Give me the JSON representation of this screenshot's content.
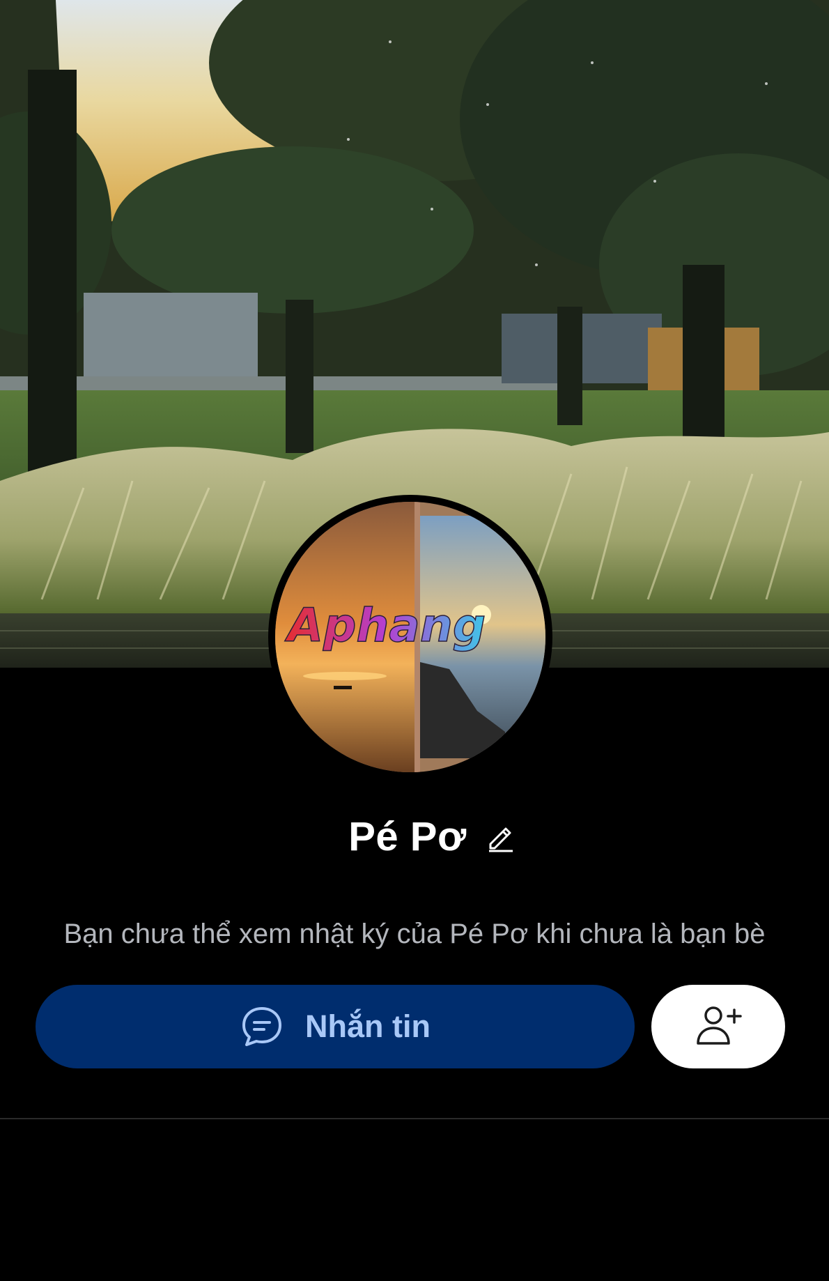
{
  "profile": {
    "name": "Pé Pơ",
    "notice": "Bạn chưa thể xem nhật ký của Pé Pơ khi chưa là bạn bè",
    "avatar_watermark": "Aphang"
  },
  "actions": {
    "message_label": "Nhắn tin"
  },
  "icons": {
    "edit": "pencil-icon",
    "message": "chat-bubble-icon",
    "add_friend": "add-user-icon"
  },
  "colors": {
    "background": "#000000",
    "message_button_bg": "#002d6e",
    "message_button_text": "#a9c8f7",
    "add_button_bg": "#ffffff",
    "notice_text": "#b4b7bd",
    "name_text": "#ffffff"
  }
}
